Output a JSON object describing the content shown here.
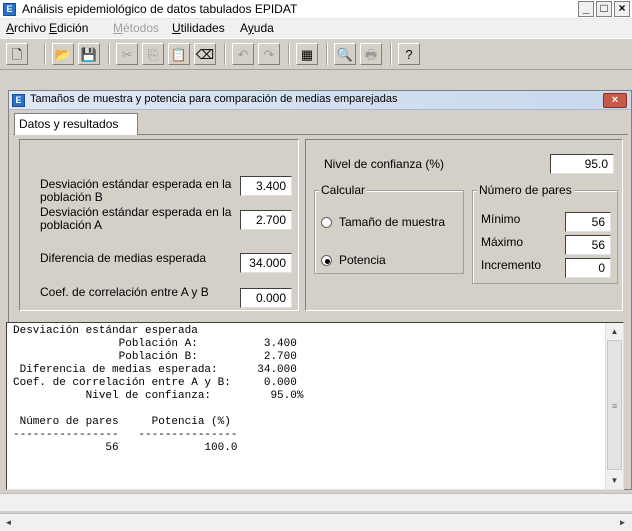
{
  "app": {
    "title": "Análisis epidemiológico de datos tabulados EPIDAT",
    "icon_letter": "E",
    "controls": [
      "_",
      "□",
      "×"
    ]
  },
  "menu": {
    "items": [
      {
        "underline": "A",
        "rest": "rchivo",
        "disabled": false
      },
      {
        "underline": "E",
        "rest": "dición",
        "disabled": false
      },
      {
        "underline": "M",
        "rest": "étodos",
        "disabled": true
      },
      {
        "underline": "U",
        "rest": "tilidades",
        "disabled": false
      },
      {
        "pre": "A",
        "underline": "y",
        "rest": "uda",
        "disabled": false
      }
    ]
  },
  "toolbar": {
    "icons": [
      {
        "name": "new-file-icon",
        "glyph": "🗋",
        "disabled": false
      },
      {
        "name": "open-folder-icon",
        "glyph": "📂",
        "disabled": true
      },
      {
        "name": "save-icon",
        "glyph": "💾",
        "disabled": true
      },
      {
        "name": "cut-icon",
        "glyph": "✂",
        "disabled": true
      },
      {
        "name": "copy-icon",
        "glyph": "⎘",
        "disabled": true
      },
      {
        "name": "paste-icon",
        "glyph": "📋",
        "disabled": false
      },
      {
        "name": "eraser-icon",
        "glyph": "⌫",
        "disabled": false
      },
      {
        "name": "undo-icon",
        "glyph": "↶",
        "disabled": true
      },
      {
        "name": "redo-icon",
        "glyph": "↷",
        "disabled": true
      },
      {
        "name": "calculator-icon",
        "glyph": "▦",
        "disabled": false
      },
      {
        "name": "print-preview-icon",
        "glyph": "🔍",
        "disabled": false
      },
      {
        "name": "print-icon",
        "glyph": "🖶",
        "disabled": true
      },
      {
        "name": "help-icon",
        "glyph": "?",
        "disabled": false
      }
    ]
  },
  "child": {
    "title": "Tamaños de muestra y potencia para comparación de medias emparejadas",
    "close": "×",
    "tab": "Datos y resultados"
  },
  "inputs": {
    "sd_b_label": "Desviación estándar esperada en la población B",
    "sd_b_value": "3.400",
    "sd_a_label": "Desviación estándar esperada en la población A",
    "sd_a_value": "2.700",
    "diff_label": "Diferencia de medias esperada",
    "diff_value": "34.000",
    "corr_label": "Coef. de correlación entre A y B",
    "corr_value": "0.000",
    "confidence_label": "Nivel de confianza (%)",
    "confidence_value": "95.0"
  },
  "calcular": {
    "legend": "Calcular",
    "option_sample": "Tamaño de muestra",
    "option_power": "Potencia",
    "selected": "Potencia"
  },
  "pairs": {
    "legend": "Número de pares",
    "min_label": "Mínimo",
    "min_value": "56",
    "max_label": "Máximo",
    "max_value": "56",
    "inc_label": "Incremento",
    "inc_value": "0"
  },
  "result_text": "Desviación estándar esperada\n                Población A:          3.400\n                Población B:          2.700\n Diferencia de medias esperada:      34.000\nCoef. de correlación entre A y B:     0.000\n           Nivel de confianza:         95.0%\n\n Número de pares     Potencia (%)\n----------------   ---------------\n              56             100.0"
}
